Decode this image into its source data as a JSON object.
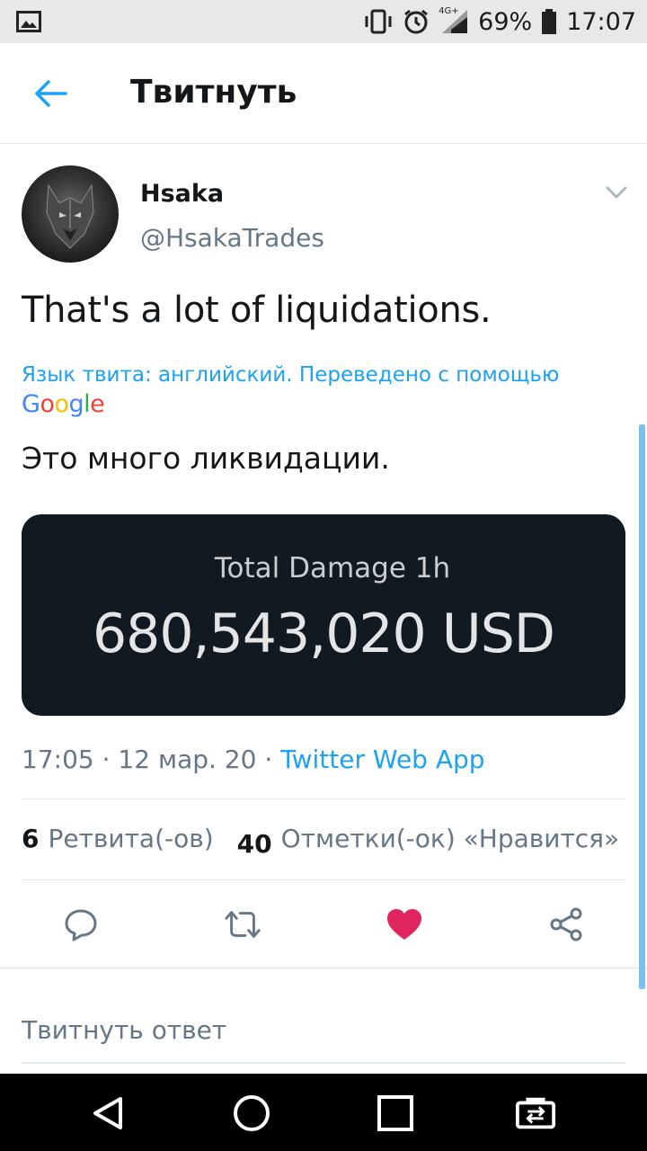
{
  "status_bar": {
    "battery": "69%",
    "time": "17:07",
    "network": "4G+",
    "icons": [
      "gallery-icon",
      "vibrate-icon",
      "alarm-icon",
      "signal-icon",
      "battery-icon"
    ]
  },
  "header": {
    "title": "Твитнуть",
    "back_icon": "arrow-left-icon"
  },
  "tweet": {
    "author_name": "Hsaka",
    "author_handle": "@HsakaTrades",
    "text": "That's a lot of liquidations.",
    "translate_note": "Язык твита: английский. Переведено с помощью",
    "translator_logo": [
      "G",
      "o",
      "o",
      "g",
      "l",
      "e"
    ],
    "translated_text": "Это много ликвидации.",
    "media": {
      "label": "Total Damage 1h",
      "value": "680,543,020 USD"
    },
    "time": "17:05",
    "date": "12 мар. 20",
    "source": "Twitter Web App",
    "retweets_count": "6",
    "retweets_label": "Ретвита(-ов)",
    "likes_count": "40",
    "likes_label": "Отметки(-ок) «Нравится»",
    "liked": true
  },
  "reply": {
    "placeholder": "Твитнуть ответ"
  },
  "colors": {
    "accent": "#1da1f2",
    "like": "#e0245e",
    "secondary_text": "#657786",
    "media_bg": "#111a21"
  }
}
